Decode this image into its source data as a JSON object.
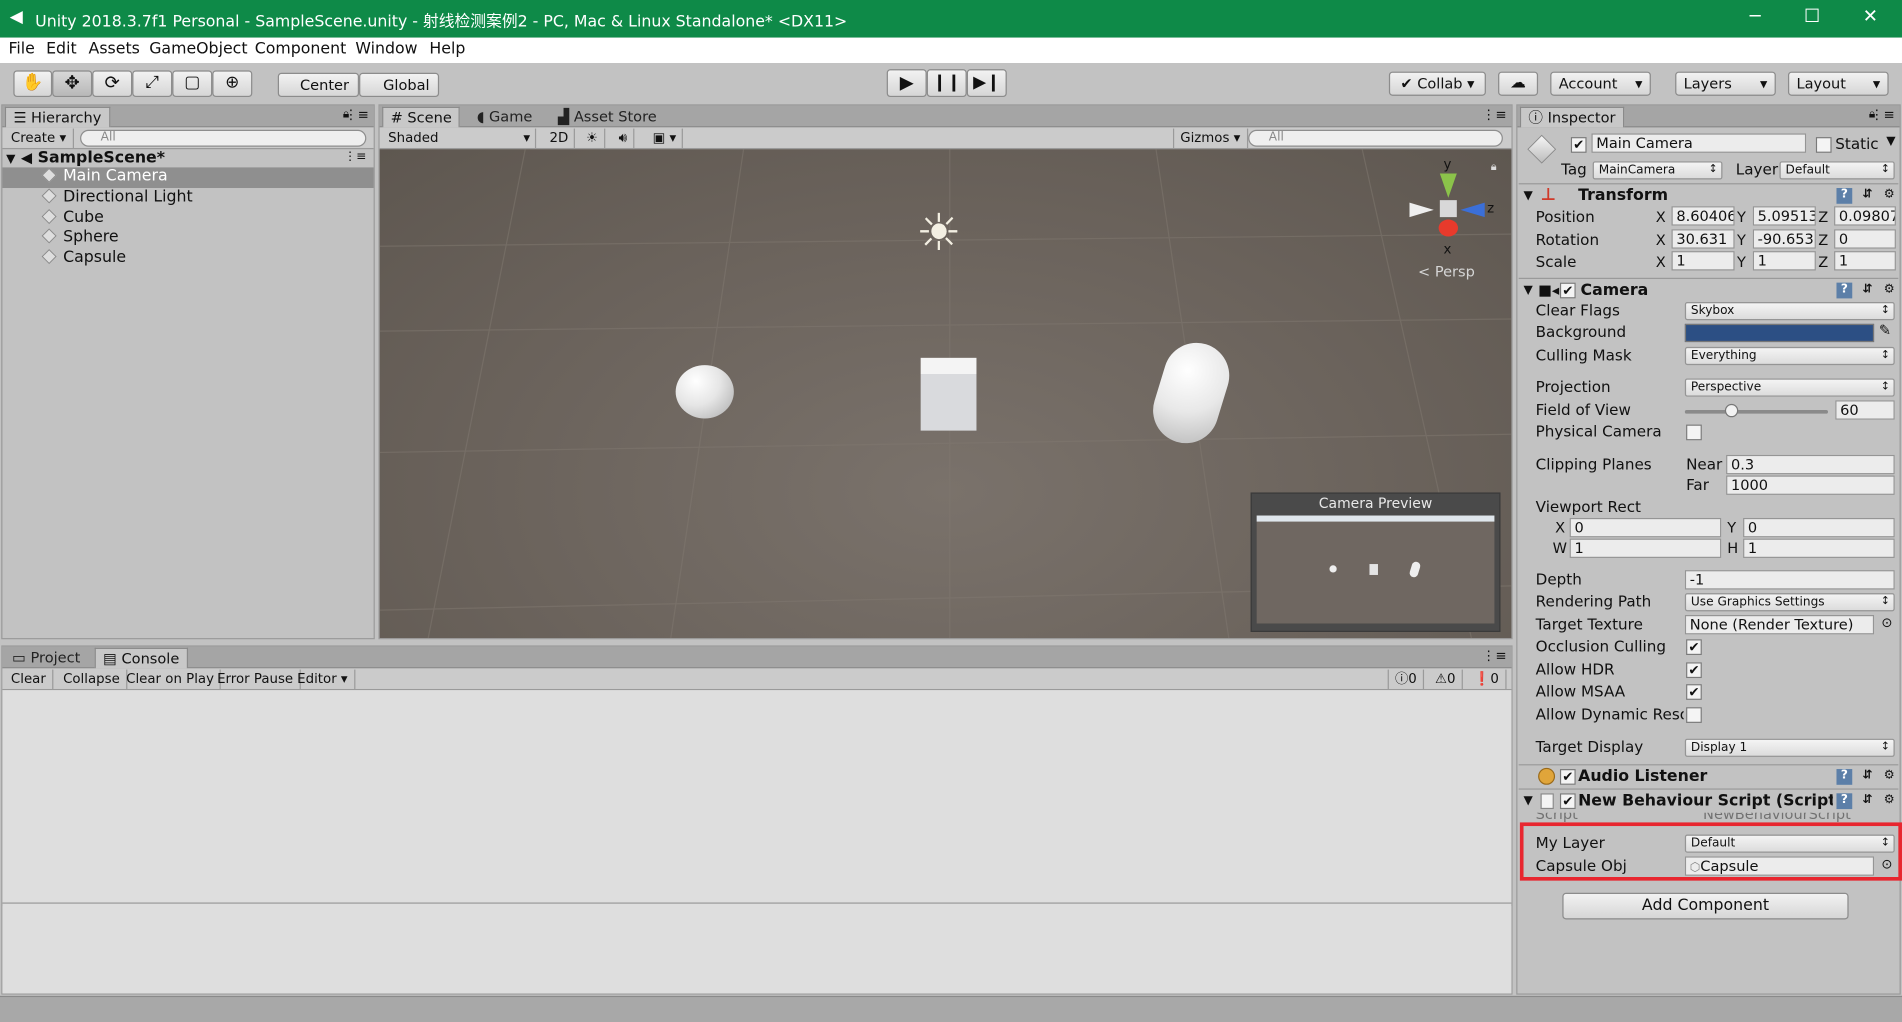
{
  "window": {
    "title": "Unity 2018.3.7f1 Personal - SampleScene.unity - 射线检测案例2 - PC, Mac & Linux Standalone* <DX11>",
    "minimize": "─",
    "maximize": "☐",
    "close": "✕"
  },
  "menu": [
    "File",
    "Edit",
    "Assets",
    "GameObject",
    "Component",
    "Window",
    "Help"
  ],
  "toolbar": {
    "center": "Center",
    "global": "Global",
    "collab": "Collab",
    "account": "Account",
    "layers": "Layers",
    "layout": "Layout"
  },
  "hierarchy": {
    "tab": "Hierarchy",
    "create": "Create",
    "search": "All",
    "scene": "SampleScene*",
    "items": [
      "Main Camera",
      "Directional Light",
      "Cube",
      "Sphere",
      "Capsule"
    ]
  },
  "scene": {
    "tabs": [
      "Scene",
      "Game",
      "Asset Store"
    ],
    "shading": "Shaded",
    "mode2d": "2D",
    "gizmos": "Gizmos",
    "search": "All",
    "persp": "Persp",
    "gizmo_y": "y",
    "gizmo_z": "z",
    "gizmo_x": "x",
    "camera_preview": "Camera Preview"
  },
  "console": {
    "tabs": [
      "Project",
      "Console"
    ],
    "buttons": [
      "Clear",
      "Collapse",
      "Clear on Play",
      "Error Pause",
      "Editor"
    ],
    "counts": [
      "0",
      "0",
      "0"
    ]
  },
  "inspector": {
    "tab": "Inspector",
    "name": "Main Camera",
    "static": "Static",
    "tag_label": "Tag",
    "tag": "MainCamera",
    "layer_label": "Layer",
    "layer": "Default",
    "transform": {
      "title": "Transform",
      "position_label": "Position",
      "rotation_label": "Rotation",
      "scale_label": "Scale",
      "position": [
        "8.60406",
        "5.09513",
        "0.09807"
      ],
      "rotation": [
        "30.631",
        "-90.653",
        "0"
      ],
      "scale": [
        "1",
        "1",
        "1"
      ]
    },
    "camera": {
      "title": "Camera",
      "clear_flags_label": "Clear Flags",
      "clear_flags": "Skybox",
      "background_label": "Background",
      "background_color": "#2c4f84",
      "culling_mask_label": "Culling Mask",
      "culling_mask": "Everything",
      "projection_label": "Projection",
      "projection": "Perspective",
      "fov_label": "Field of View",
      "fov": "60",
      "fov_fraction": 0.33,
      "physical_label": "Physical Camera",
      "clipping_label": "Clipping Planes",
      "near_label": "Near",
      "near": "0.3",
      "far_label": "Far",
      "far": "1000",
      "viewport_label": "Viewport Rect",
      "vx": "0",
      "vy": "0",
      "vw": "1",
      "vh": "1",
      "depth_label": "Depth",
      "depth": "-1",
      "rendering_label": "Rendering Path",
      "rendering": "Use Graphics Settings",
      "target_texture_label": "Target Texture",
      "target_texture": "None (Render Texture)",
      "occlusion_label": "Occlusion Culling",
      "hdr_label": "Allow HDR",
      "msaa_label": "Allow MSAA",
      "dynamic_label": "Allow Dynamic Resolu",
      "display_label": "Target Display",
      "display": "Display 1"
    },
    "audio_listener": "Audio Listener",
    "script": {
      "title": "New Behaviour Script (Script",
      "script_label": "Script",
      "script_value": "NewBehaviourScript",
      "my_layer_label": "My Layer",
      "my_layer": "Default",
      "capsule_label": "Capsule Obj",
      "capsule": "Capsule"
    },
    "add_component": "Add Component"
  },
  "axis_labels": {
    "x": "X",
    "y": "Y",
    "z": "Z",
    "w": "W",
    "h": "H"
  },
  "colors": {
    "titlebar": "#0e8a48",
    "scene_bg": "#6b635c",
    "highlight": "#e8262f"
  }
}
